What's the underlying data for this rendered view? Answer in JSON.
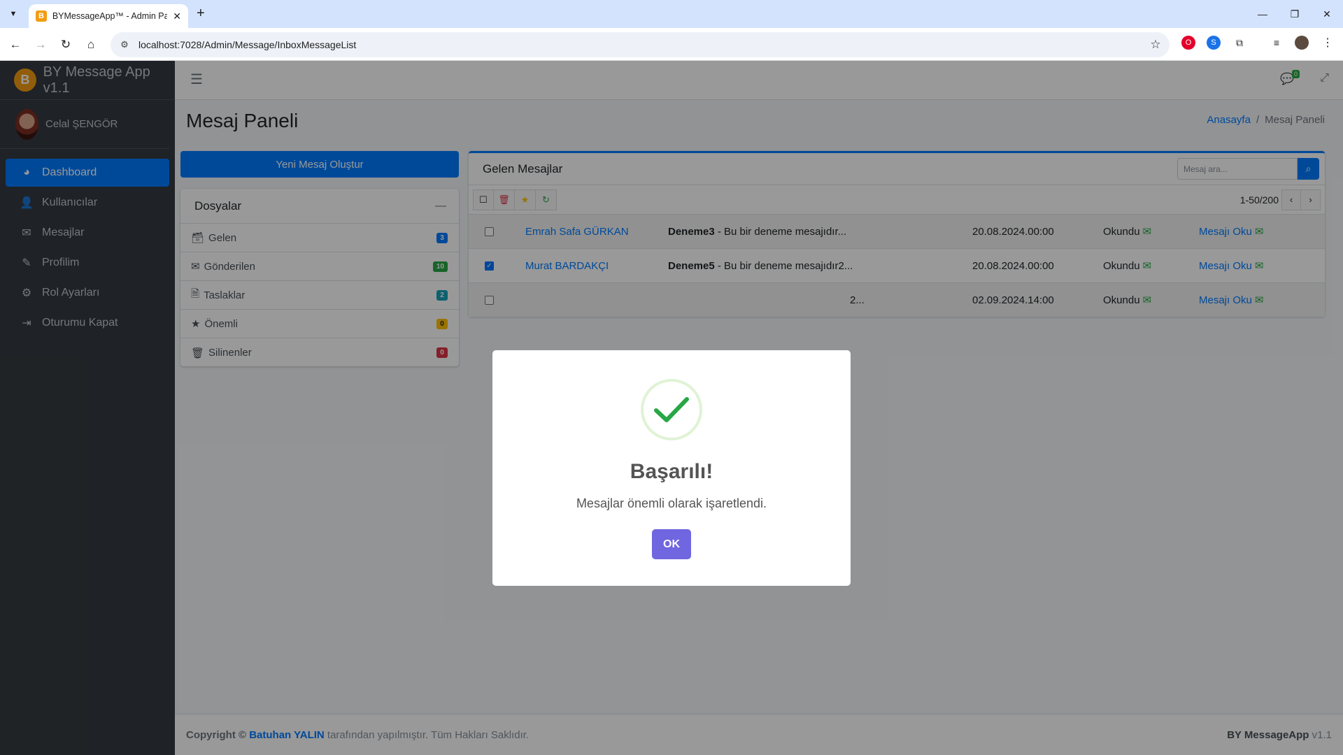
{
  "browser": {
    "tab_title": "BYMessageApp™ - Admin Panel",
    "favicon_letter": "B",
    "url": "localhost:7028/Admin/Message/InboxMessageList"
  },
  "sidebar": {
    "brand": "BY Message App v1.1",
    "brand_letter": "B",
    "user_name": "Celal ŞENGÖR",
    "items": [
      {
        "label": "Dashboard",
        "icon": "palette-icon",
        "active": true
      },
      {
        "label": "Kullanıcılar",
        "icon": "user-icon"
      },
      {
        "label": "Mesajlar",
        "icon": "envelope-icon"
      },
      {
        "label": "Profilim",
        "icon": "user-edit-icon"
      },
      {
        "label": "Rol Ayarları",
        "icon": "cogs-icon"
      },
      {
        "label": "Oturumu Kapat",
        "icon": "sign-out-icon"
      }
    ]
  },
  "header": {
    "message_count": "0"
  },
  "page": {
    "title": "Mesaj Paneli",
    "breadcrumb_home": "Anasayfa",
    "breadcrumb_sep": "/",
    "breadcrumb_current": "Mesaj Paneli"
  },
  "compose_label": "Yeni Mesaj Oluştur",
  "folders": {
    "title": "Dosyalar",
    "items": [
      {
        "label": "Gelen",
        "count": "3",
        "color": "#007bff"
      },
      {
        "label": "Gönderilen",
        "count": "10",
        "color": "#28a745"
      },
      {
        "label": "Taslaklar",
        "count": "2",
        "color": "#17a2b8"
      },
      {
        "label": "Önemli",
        "count": "0",
        "color": "#ffc107"
      },
      {
        "label": "Silinenler",
        "count": "0",
        "color": "#dc3545"
      }
    ]
  },
  "inbox": {
    "title": "Gelen Mesajlar",
    "search_placeholder": "Mesaj ara...",
    "pager": "1-50/200",
    "rows": [
      {
        "checked": false,
        "sender": "Emrah Safa GÜRKAN",
        "subject": "Deneme3",
        "preview": " - Bu bir deneme mesajıdır...",
        "date": "20.08.2024.00:00",
        "status": "Okundu",
        "action": "Mesajı Oku"
      },
      {
        "checked": true,
        "sender": "Murat BARDAKÇI",
        "subject": "Deneme5",
        "preview": " - Bu bir deneme mesajıdır2...",
        "date": "20.08.2024.00:00",
        "status": "Okundu",
        "action": "Mesajı Oku"
      },
      {
        "checked": false,
        "sender": "",
        "subject": "",
        "preview": "2...",
        "date": "02.09.2024.14:00",
        "status": "Okundu",
        "action": "Mesajı Oku"
      }
    ]
  },
  "footer": {
    "copyright": "Copyright ©",
    "author": "Batuhan YALIN",
    "rest": "tarafından yapılmıştır. Tüm Hakları Saklıdır.",
    "app_name": "BY MessageApp",
    "version": "v1.1"
  },
  "modal": {
    "title": "Başarılı!",
    "text": "Mesajlar önemli olarak işaretlendi.",
    "ok_label": "OK",
    "success_color": "#28a745",
    "button_color": "#7066e0"
  }
}
